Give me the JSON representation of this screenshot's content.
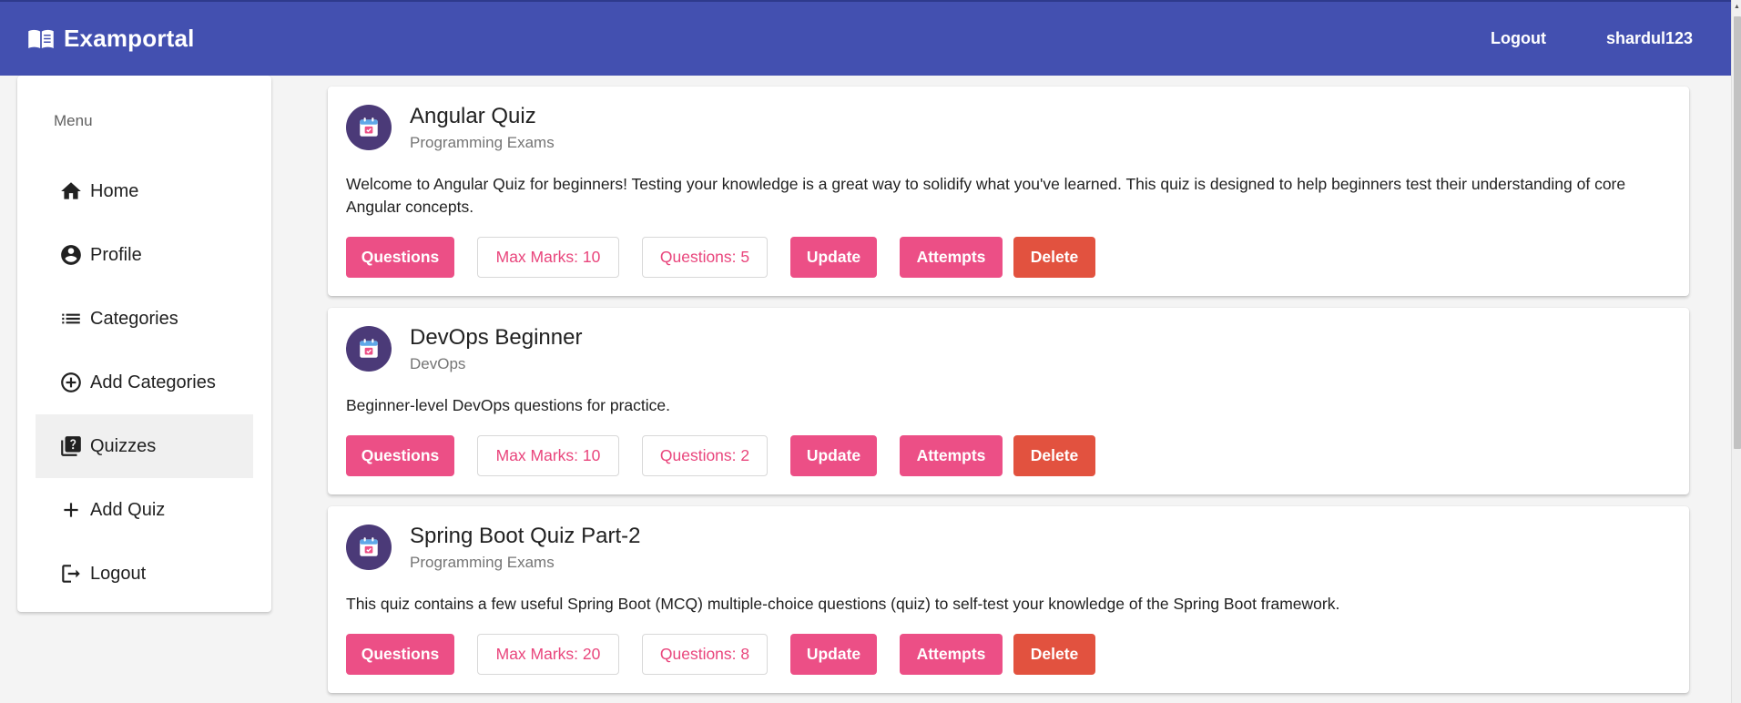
{
  "app": {
    "title": "Examportal"
  },
  "header": {
    "logout_label": "Logout",
    "username": "shardul123"
  },
  "sidebar": {
    "header": "Menu",
    "items": [
      {
        "label": "Home",
        "icon": "home-icon"
      },
      {
        "label": "Profile",
        "icon": "account-circle-icon"
      },
      {
        "label": "Categories",
        "icon": "list-icon"
      },
      {
        "label": "Add Categories",
        "icon": "add-circle-icon"
      },
      {
        "label": "Quizzes",
        "icon": "quiz-icon",
        "active": true
      },
      {
        "label": "Add Quiz",
        "icon": "plus-icon"
      },
      {
        "label": "Logout",
        "icon": "logout-icon"
      }
    ]
  },
  "quizzes": [
    {
      "title": "Angular Quiz",
      "category": "Programming Exams",
      "description": "Welcome to Angular Quiz for beginners! Testing your knowledge is a great way to solidify what you've learned. This quiz is designed to help beginners test their understanding of core Angular concepts.",
      "questions_btn": "Questions",
      "max_marks": "Max Marks: 10",
      "question_count": "Questions: 5",
      "update_btn": "Update",
      "attempts_btn": "Attempts",
      "delete_btn": "Delete"
    },
    {
      "title": "DevOps Beginner",
      "category": "DevOps",
      "description": "Beginner-level DevOps questions for practice.",
      "questions_btn": "Questions",
      "max_marks": "Max Marks: 10",
      "question_count": "Questions: 2",
      "update_btn": "Update",
      "attempts_btn": "Attempts",
      "delete_btn": "Delete"
    },
    {
      "title": "Spring Boot Quiz Part-2",
      "category": "Programming Exams",
      "description": "This quiz contains a few useful Spring Boot (MCQ) multiple-choice questions (quiz) to self-test your knowledge of the Spring Boot framework.",
      "questions_btn": "Questions",
      "max_marks": "Max Marks: 20",
      "question_count": "Questions: 8",
      "update_btn": "Update",
      "attempts_btn": "Attempts",
      "delete_btn": "Delete"
    }
  ],
  "colors": {
    "toolbar": "#4350b0",
    "accent_pink": "#ec4f86",
    "warn_red": "#e2523f",
    "avatar_bg": "#4b3a78"
  }
}
